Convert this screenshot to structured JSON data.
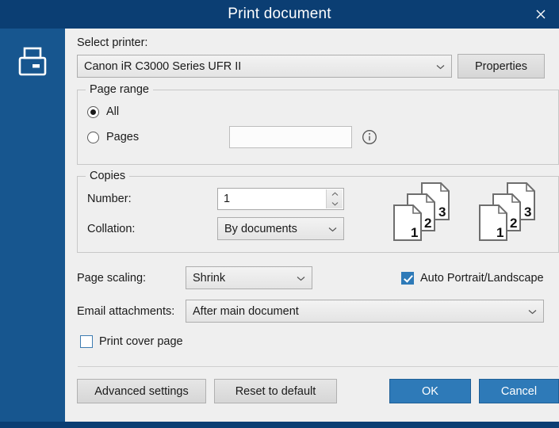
{
  "window": {
    "title": "Print document",
    "close_icon": "close-icon",
    "sidebar_icon": "printer-icon",
    "accent_blue": "#2e7ab8",
    "titlebar_blue": "#0b3e73",
    "sidebar_blue": "#17568f"
  },
  "printer": {
    "label": "Select printer:",
    "selected": "Canon iR C3000 Series UFR II",
    "properties_label": "Properties"
  },
  "page_range": {
    "title": "Page range",
    "all_label": "All",
    "all_selected": true,
    "pages_label": "Pages",
    "pages_selected": false,
    "pages_value": "",
    "pages_placeholder": "",
    "info_icon": "info-icon"
  },
  "copies": {
    "title": "Copies",
    "number_label": "Number:",
    "number_value": "1",
    "collation_label": "Collation:",
    "collation_selected": "By documents",
    "preview": {
      "groups": 2,
      "page_numbers": [
        "1",
        "2",
        "3"
      ]
    }
  },
  "scaling": {
    "label": "Page scaling:",
    "selected": "Shrink",
    "auto_orientation_label": "Auto Portrait/Landscape",
    "auto_orientation_checked": true
  },
  "email": {
    "label": "Email attachments:",
    "selected": "After main document"
  },
  "cover": {
    "label": "Print cover page",
    "checked": false
  },
  "footer": {
    "advanced_label": "Advanced settings",
    "reset_label": "Reset to default",
    "ok_label": "OK",
    "cancel_label": "Cancel"
  }
}
